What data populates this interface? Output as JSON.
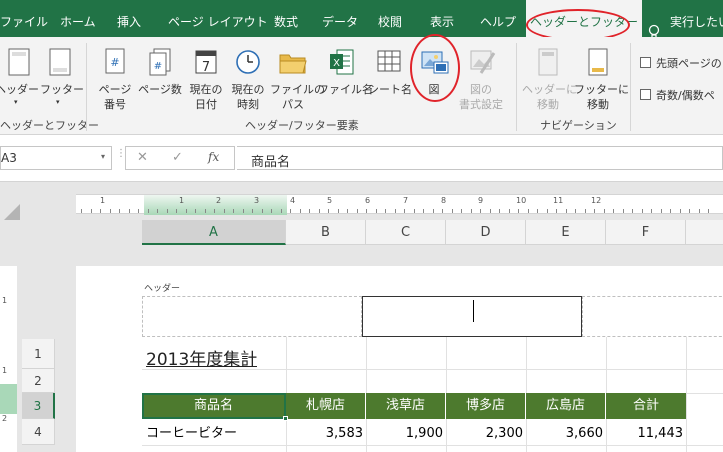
{
  "ribbon_tabs": [
    {
      "label": "ファイル"
    },
    {
      "label": "ホーム"
    },
    {
      "label": "挿入"
    },
    {
      "label": "ページ レイアウト"
    },
    {
      "label": "数式"
    },
    {
      "label": "データ"
    },
    {
      "label": "校閲"
    },
    {
      "label": "表示"
    },
    {
      "label": "ヘルプ"
    },
    {
      "label": "ヘッダーとフッター",
      "active": true
    },
    {
      "label": "実行したい"
    }
  ],
  "ribbon": {
    "header_btn": "ヘッダー",
    "footer_btn": "フッター",
    "group_header_footer": "ヘッダーとフッター",
    "page_number": [
      "ページ",
      "番号"
    ],
    "page_count": "ページ数",
    "current_date": [
      "現在の",
      "日付"
    ],
    "current_time": [
      "現在の",
      "時刻"
    ],
    "file_path": [
      "ファイルの",
      "パス"
    ],
    "file_name": "ファイル名",
    "sheet_name": "シート名",
    "picture": "図",
    "format_picture": [
      "図の",
      "書式設定"
    ],
    "group_elements": "ヘッダー/フッター要素",
    "goto_header": [
      "ヘッダーに",
      "移動"
    ],
    "goto_footer": [
      "フッターに",
      "移動"
    ],
    "group_navigation": "ナビゲーション",
    "opt_first_page": "先頭ページの",
    "opt_odd_even": "奇数/偶数ペ",
    "calendar_day": "7"
  },
  "formula_bar": {
    "name_box": "A3",
    "content": "商品名",
    "fx": "fx"
  },
  "ruler_numbers": [
    "1",
    "1",
    "2",
    "3",
    "4",
    "5",
    "6",
    "7",
    "8",
    "9",
    "10",
    "11",
    "12"
  ],
  "columns": [
    "A",
    "B",
    "C",
    "D",
    "E",
    "F"
  ],
  "rows": [
    "1",
    "2",
    "3",
    "4"
  ],
  "page": {
    "header_label": "ヘッダー"
  },
  "sheet": {
    "title": "2013年度集計",
    "headers": [
      "商品名",
      "札幌店",
      "浅草店",
      "博多店",
      "広島店",
      "合計"
    ],
    "row4": [
      "コーヒービター",
      "3,583",
      "1,900",
      "2,300",
      "3,660",
      "11,443"
    ]
  },
  "colors": {
    "excel_green": "#217346",
    "header_fill": "#4d7a2e",
    "annotation_red": "#e0232a"
  }
}
